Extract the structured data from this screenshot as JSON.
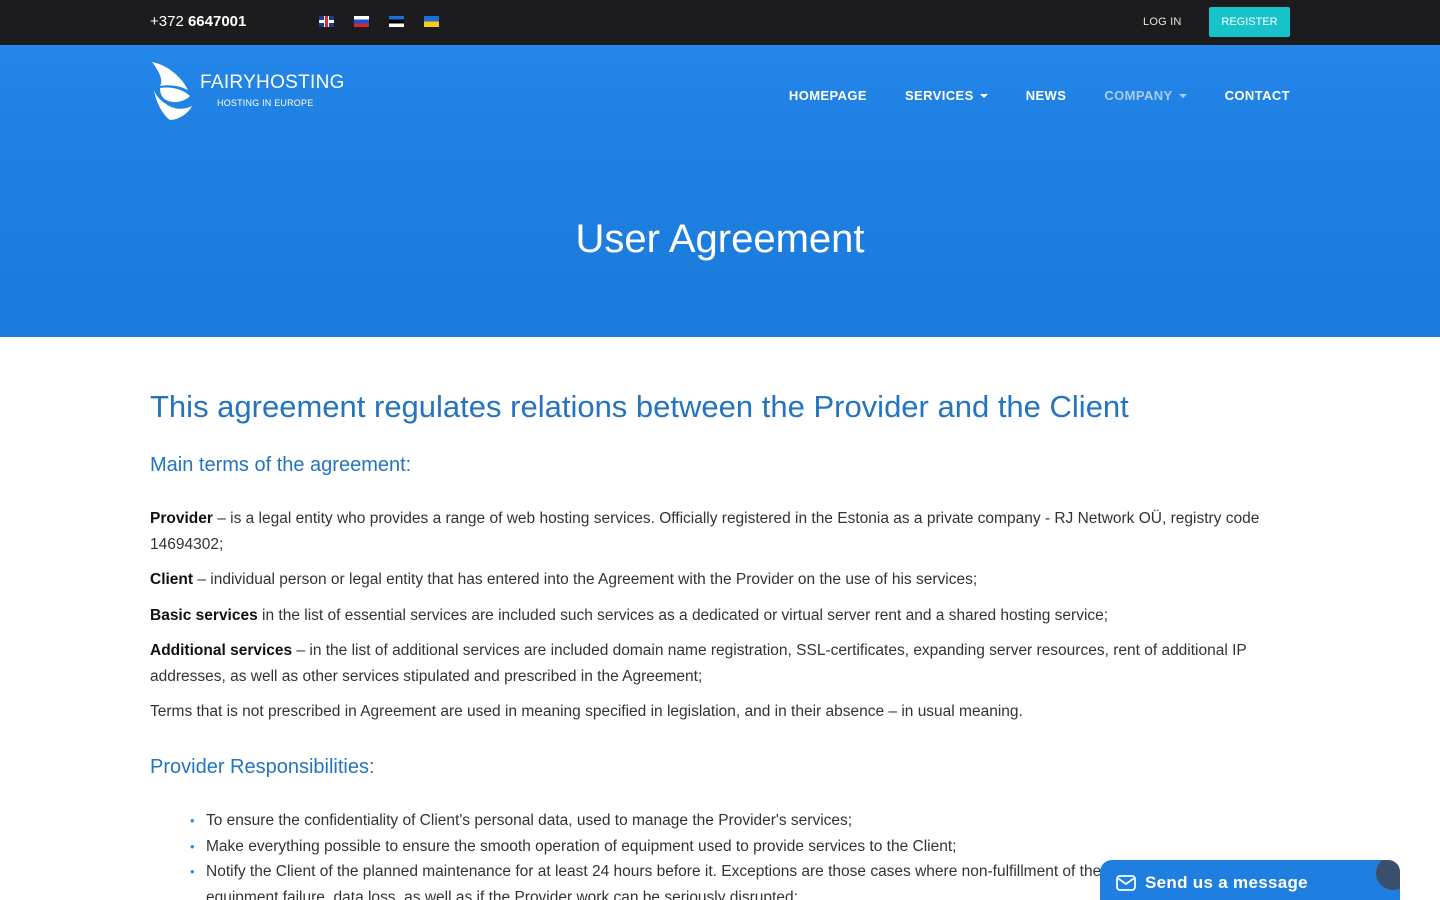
{
  "topbar": {
    "phone_prefix": "+372",
    "phone_number": "6647001",
    "languages": [
      "English",
      "Russian",
      "Estonian",
      "Ukrainian"
    ],
    "login_label": "LOG IN",
    "register_label": "REGISTER"
  },
  "header": {
    "logo_name": "FAIRYHOSTING",
    "logo_tagline": "HOSTING IN EUROPE",
    "nav": [
      {
        "label": "HOMEPAGE"
      },
      {
        "label": "SERVICES"
      },
      {
        "label": "NEWS"
      },
      {
        "label": "COMPANY"
      },
      {
        "label": "CONTACT"
      }
    ],
    "hero_title": "User Agreement"
  },
  "content": {
    "main_heading": "This agreement regulates relations between the Provider and the Client",
    "terms_heading": "Main terms of the agreement:",
    "terms": [
      {
        "term": "Provider",
        "text": " – is a legal entity who provides a range of web hosting services. Officially registered in the Estonia as a private company - RJ Network OÜ, registry code 14694302;"
      },
      {
        "term": "Client",
        "text": " – individual person or legal entity that has entered into the Agreement with the Provider on the use of his services;"
      },
      {
        "term": "Basic services",
        "text": " in the list of essential services are included such services as a dedicated or virtual server rent and a shared hosting service;"
      },
      {
        "term": "Additional services",
        "text": " – in the list of additional services are included domain name registration, SSL-certificates, expanding server resources, rent of additional IP addresses, as well as other services stipulated and prescribed in the Agreement;"
      }
    ],
    "terms_note": "Terms that is not prescribed in Agreement are used in meaning specified in legislation, and in their absence – in usual meaning.",
    "responsibilities_heading": "Provider Responsibilities:",
    "responsibilities": [
      "To ensure the confidentiality of Client's personal data, used to manage the Provider's services;",
      "Make everything possible to ensure the smooth operation of equipment used to provide services to the Client;",
      "Notify the Client of the planned maintenance for at least 24 hours before it. Exceptions are those cases where non-fulfillment of the work can lead to equipment failure, data loss, as well as if the Provider work can be seriously disrupted;"
    ]
  },
  "chat": {
    "label": "Send us a message"
  }
}
